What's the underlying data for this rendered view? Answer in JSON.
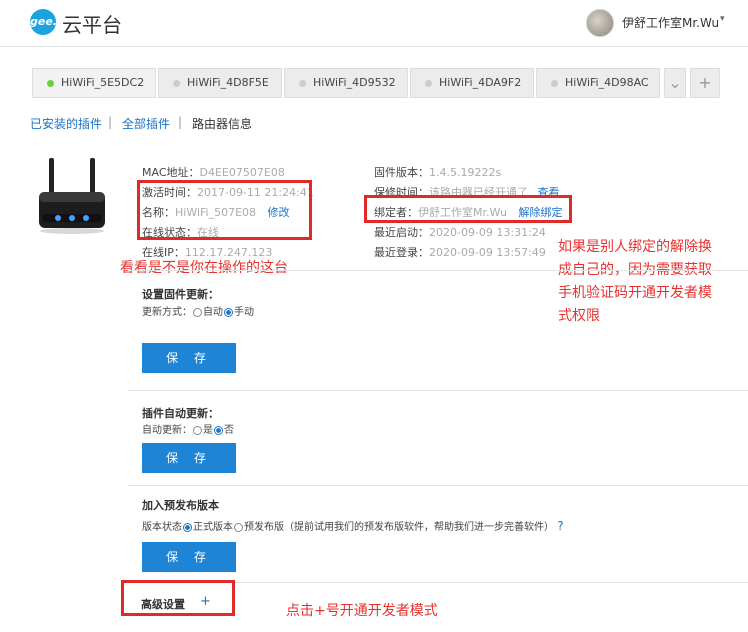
{
  "header": {
    "logo_mark": "gee.",
    "logo_text": "云平台",
    "user_name": "伊舒工作室Mr.Wu",
    "caret": "▾"
  },
  "tabs": [
    {
      "label": "HiWiFi_5E5DC2",
      "active": true
    },
    {
      "label": "HiWiFi_4D8F5E",
      "active": false
    },
    {
      "label": "HiWiFi_4D9532",
      "active": false
    },
    {
      "label": "HiWiFi_4DA9F2",
      "active": false
    },
    {
      "label": "HiWiFi_4D98AC",
      "active": false
    }
  ],
  "tab_buttons": {
    "more": "⌄",
    "add": "+"
  },
  "subnav": {
    "installed": "已安装的插件",
    "sep1": "|",
    "all": "全部插件",
    "sep2": "|",
    "router_info": "路由器信息"
  },
  "router": {
    "mac_label": "MAC地址：",
    "mac_value": "D4EE07507E08",
    "activate_label": "激活时间：",
    "activate_value": "2017-09-11 21:24:41",
    "name_label": "名称：",
    "name_value": "HiWiFi_507E08",
    "name_edit": "修改",
    "status_label": "在线状态：",
    "status_value": "在线",
    "ip_label": "在线IP：",
    "ip_value": "112.17.247.123",
    "fw_label": "固件版本：",
    "fw_value": "1.4.5.19222s",
    "warranty_label": "保修时间：",
    "warranty_value": "该路由器已经开通了",
    "warranty_link": "查看",
    "bound_label": "绑定者：",
    "bound_value": "伊舒工作室Mr.Wu",
    "unbind": "解除绑定",
    "last_boot_label": "最近启动：",
    "last_boot_value": "2020-09-09 13:31:24",
    "last_login_label": "最近登录：",
    "last_login_value": "2020-09-09 13:57:49"
  },
  "annotations": {
    "check_router": "看看是不是你在操作的这台",
    "unbind_note_1": "如果是别人绑定的解除换",
    "unbind_note_2": "成自己的，因为需要获取",
    "unbind_note_3": "手机验证码开通开发者模",
    "unbind_note_4": "式权限",
    "click_plus": "点击+号开通开发者模式"
  },
  "firmware_update": {
    "title": "设置固件更新：",
    "mode_label": "更新方式：",
    "opt_auto": "自动",
    "opt_manual": "手动",
    "save": "保 存"
  },
  "plugin_update": {
    "title": "插件自动更新：",
    "mode_label": "自动更新：",
    "opt_yes": "是",
    "opt_no": "否",
    "save": "保 存"
  },
  "prerelease": {
    "title": "加入预发布版本",
    "state_label": "版本状态",
    "opt_official": "正式版本",
    "opt_pre": "预发布版（提前试用我们的预发布版软件，帮助我们进一步完善软件）",
    "help": "?",
    "save": "保 存"
  },
  "advanced": {
    "title": "高级设置",
    "plus": "+"
  }
}
